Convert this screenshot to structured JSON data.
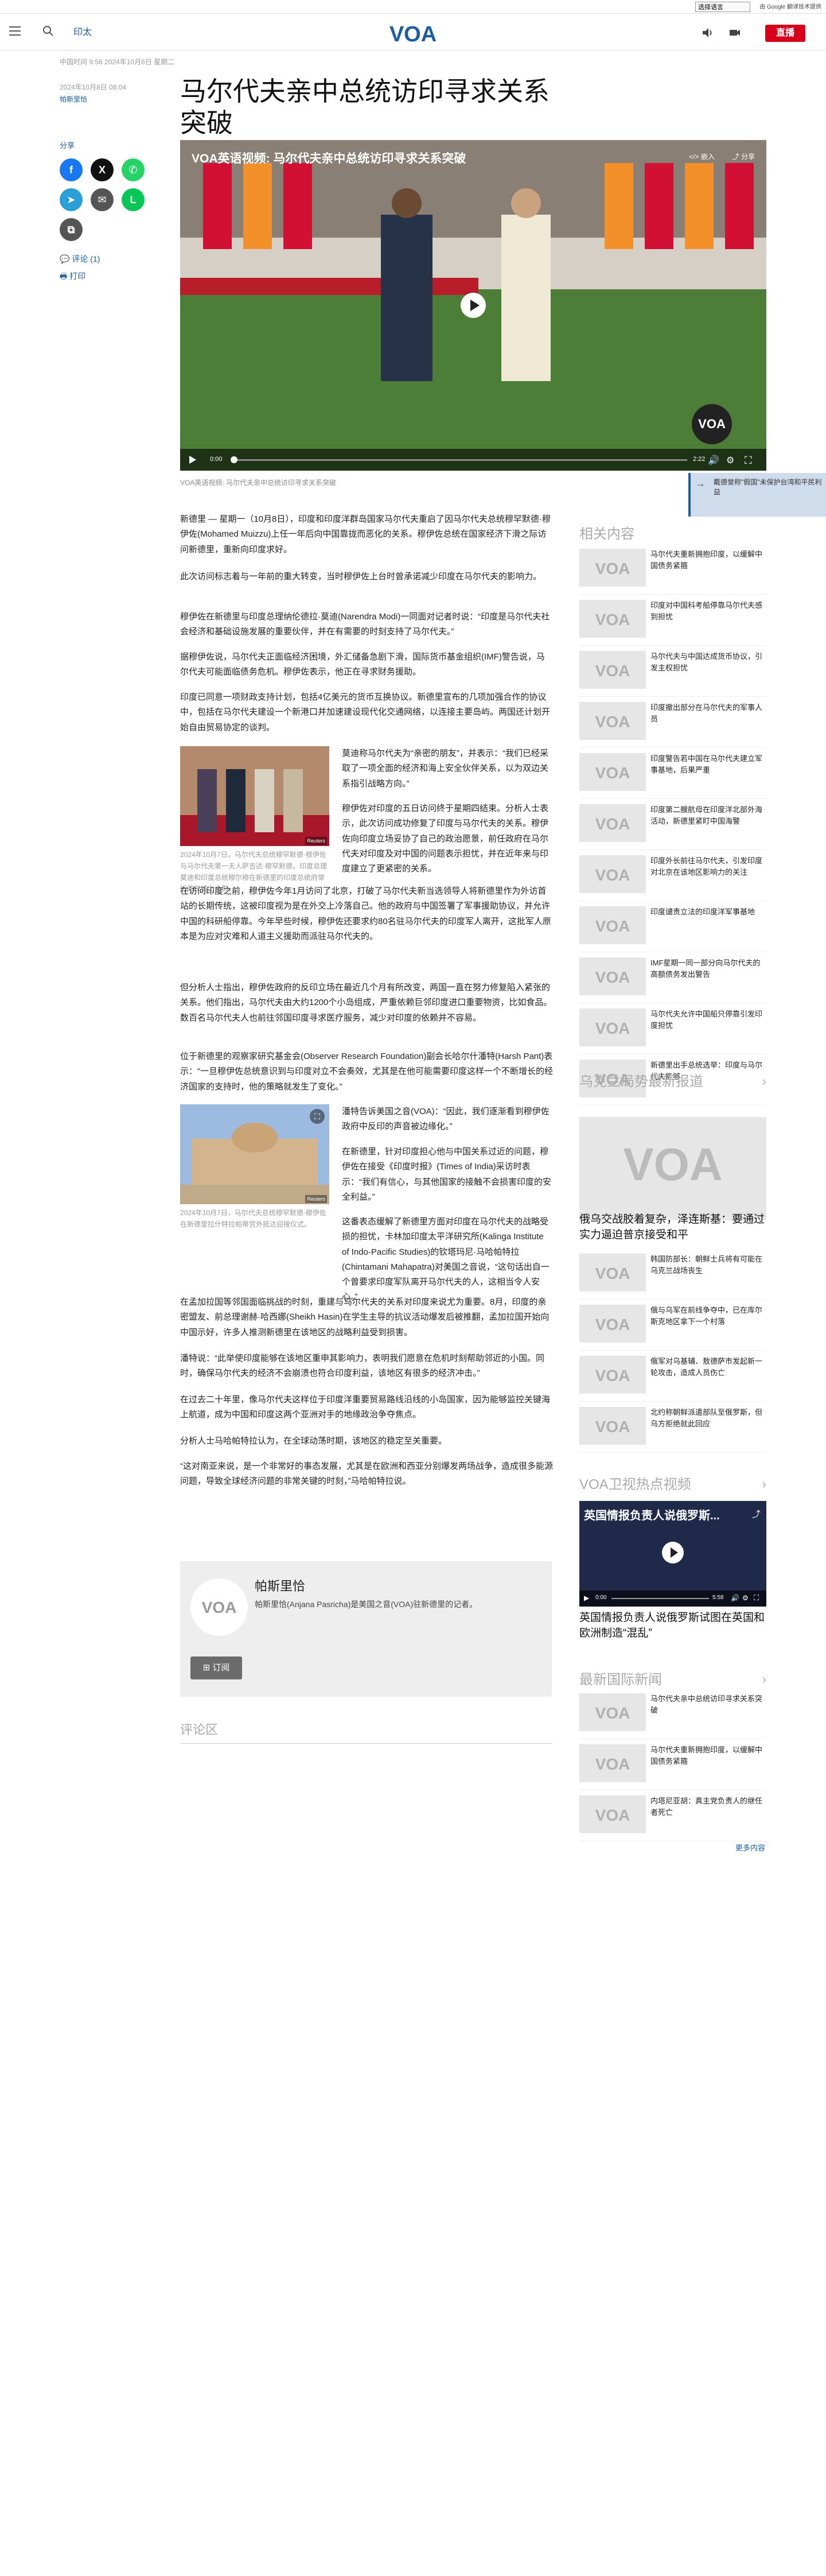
{
  "topbar": {
    "lang_select": "选择语言",
    "translate_label": "由 Google 翻译技术提供"
  },
  "header": {
    "nav_label": "印太",
    "logo_text": "VOA",
    "live_label": "直播"
  },
  "article_meta": {
    "dateline": "中国时间 9:56 2024年10月8日 星期二",
    "updated": "2024年10月8日 08:04",
    "author_link": "帕斯里恰"
  },
  "article": {
    "title": "马尔代夫亲中总统访印寻求关系突破",
    "share_label": "分享",
    "comment_link": "评论 (1)",
    "print_link": "打印",
    "video_title": "VOA英语视频: 马尔代夫亲中总统访印寻求关系突破",
    "video_share": "分享",
    "video_embed": "嵌入",
    "video_time_current": "0:00",
    "video_time_total": "2:22",
    "video_progress": 0.0,
    "video_caption": "VOA英语视频: 马尔代夫亲中总统访印寻求关系突破",
    "paragraphs": [
      "新德里 — 星期一（10月8日），印度和印度洋群岛国家马尔代夫重启了因马尔代夫总统穆罕默德·穆伊佐(Mohamed Muizzu)上任一年后向中国靠拢而恶化的关系。穆伊佐总统在国家经济下滑之际访问新德里，重新向印度求好。",
      "此次访问标志着与一年前的重大转变，当时穆伊佐上台时曾承诺减少印度在马尔代夫的影响力。",
      "穆伊佐在新德里与印度总理纳伦德拉·莫迪(Narendra Modi)一同面对记者时说：“印度是马尔代夫社会经济和基础设施发展的重要伙伴，并在有需要的时刻支持了马尔代夫。”",
      "据穆伊佐说，马尔代夫正面临经济困境，外汇储备急剧下滑，国际货币基金组织(IMF)警告说，马尔代夫可能面临债务危机。穆伊佐表示，他正在寻求财务援助。",
      "印度已同意一项财政支持计划，包括4亿美元的货币互换协议。新德里宣布的几项加强合作的协议中，包括在马尔代夫建设一个新港口并加速建设现代化交通网络，以连接主要岛屿。两国还计划开始自由贸易协定的谈判。",
      "莫迪称马尔代夫为“亲密的朋友”，并表示：“我们已经采取了一项全面的经济和海上安全伙伴关系，以为双边关系指引战略方向。”",
      "穆伊佐对印度的五日访问终于星期四结束。分析人士表示，此次访问成功修复了印度与马尔代夫的关系。穆伊佐向印度立场妥协了自己的政治愿景，前任政府在马尔代夫对印度及对中国的问题表示担忧，并在近年来与印度建立了更紧密的关系。",
      "在访问印度之前，穆伊佐今年1月访问了北京，打破了马尔代夫新当选领导人将新德里作为外访首站的长期传统，这被印度视为是在外交上冷落自己。他的政府与中国签署了军事援助协议，并允许中国的科研船停靠。今年早些时候，穆伊佐还要求约80名驻马尔代夫的印度军人离开，这批军人原本是为应对灾难和人道主义援助而派驻马尔代夫的。",
      "但分析人士指出，穆伊佐政府的反印立场在最近几个月有所改变，两国一直在努力修复陷入紧张的关系。他们指出，马尔代夫由大约1200个小岛组成，严重依赖巨邻印度进口重要物资，比如食品。数百名马尔代夫人也前往邻国印度寻求医疗服务，减少对印度的依赖并不容易。",
      "位于新德里的观察家研究基金会(Observer Research Foundation)副会长哈尔什潘特(Harsh Pant)表示：“一旦穆伊佐总统意识到与印度对立不会奏效，尤其是在他可能需要印度这样一个不断增长的经济国家的支持时，他的策略就发生了变化。”",
      "潘特告诉美国之音(VOA)：“因此，我们逐渐看到穆伊佐政府中反印的声音被边缘化。”",
      "在新德里，针对印度担心他与中国关系过近的问题，穆伊佐在接受《印度时报》(Times of India)采访时表示：“我们有信心，与其他国家的接触不会损害印度的安全利益。”",
      "这番表态缓解了新德里方面对印度在马尔代夫的战略受损的担忧，卡林加印度太平洋研究所(Kalinga Institute of Indo-Pacific Studies)的钦塔玛尼·马哈帕特拉(Chintamani Mahapatra)对美国之音说，“这句话出自一个曾要求印度军队离开马尔代夫的人，这相当令人安心。”",
      "在孟加拉国等邻国面临挑战的时刻，重建与马尔代夫的关系对印度来说尤为重要。8月，印度的亲密盟友、前总理谢赫·哈西娜(Sheikh Hasin)在学生主导的抗议活动爆发后被推翻，孟加拉国开始向中国示好，许多人推测新德里在该地区的战略利益受到损害。",
      "潘特说：“此举使印度能够在该地区重申其影响力，表明我们愿意在危机时刻帮助邻近的小国。同时，确保马尔代夫的经济不会崩溃也符合印度利益，该地区有很多的经济冲击。”",
      "在过去二十年里，像马尔代夫这样位于印度洋重要贸易路线沿线的小岛国家，因为能够监控关键海上航道，成为中国和印度这两个亚洲对手的地缘政治争夺焦点。",
      "分析人士马哈帕特拉认为，在全球动荡时期，该地区的稳定至关重要。",
      "“这对南亚来说，是一个非常好的事态发展，尤其是在欧洲和西亚分别爆发两场战争，造成很多能源问题，导致全球经济问题的非常关键的时刻，”马哈帕特拉说。"
    ],
    "photo1_caption": "2024年10月7日，马尔代夫总统穆罕默德·穆伊佐与马尔代夫第一夫人萨吉达·穆罕默德、印度总理莫迪和印度总统穆尔穆在新德里的印度总统府举行的仪式上合影。",
    "photo1_credit": "Reuters",
    "photo2_caption": "2024年10月7日，马尔代夫总统穆罕默德·穆伊佐在新德里拉什特拉帕蒂宫外抵达迎接仪式。",
    "photo2_credit": "Reuters"
  },
  "author_box": {
    "name": "帕斯里恰",
    "desc": "帕斯里恰(Anjana Pasricha)是美国之音(VOA)驻新德里的记者。",
    "subscribe": "订阅"
  },
  "comments": {
    "heading": "评论区"
  },
  "sidebar": {
    "related_heading": "相关内容",
    "related": [
      "马尔代夫重新拥抱印度，以缓解中国债务紧箍",
      "印度对中国科考船停靠马尔代夫感到担忧",
      "马尔代夫与中国达成货币协议，引发主权担忧",
      "印度撤出部分在马尔代夫的军事人员",
      "印度警告若中国在马尔代夫建立军事基地，后果严重",
      "印度第二艘航母在印度洋北部外海活动，新德里紧盯中国海警",
      "印度外长前往马尔代夫，引发印度对北京在该地区影响力的关注",
      "印度谴责立法的印度洋军事基地",
      "IMF星期一同一部分向马尔代夫的高额债务发出警告",
      "马尔代夫允许中国船只停靠引发印度担忧",
      "新德里出手总统选举：印度与马尔代夫能够"
    ],
    "ukraine_heading": "乌克兰局势最新报道",
    "ukraine_big_title": "俄乌交战胶着复杂，泽连斯基：要通过实力逼迫普京接受和平",
    "ukraine_items": [
      "韩国防部长：朝鲜士兵将有可能在乌克兰战场丧生",
      "俄与乌军在前线争夺中，已在库尔斯克地区拿下一个村落",
      "俄军对乌基辅、敖德萨市发起新一轮攻击，造成人员伤亡",
      "北约称朝鲜派遣部队至俄罗斯，但乌方拒绝就此回应"
    ],
    "tv_heading": "VOA卫视热点视频",
    "tv_video_text": "英国情报负责人说俄罗斯...",
    "tv_time_current": "0:00",
    "tv_time_total": "5:58",
    "tv_title": "英国情报负责人说俄罗斯试图在英国和欧洲制造“混乱”",
    "intl_heading": "最新国际新闻",
    "intl_items": [
      "马尔代夫亲中总统访印寻求关系突破",
      "马尔代夫重新拥抱印度，以缓解中国债务紧箍",
      "内塔尼亚胡：真主党负责人的继任者死亡"
    ],
    "more_label": "更多内容"
  },
  "floating_banner": {
    "text": "戴德誉称\"假国\"未保护台湾和平民利益"
  },
  "colors": {
    "brand_blue": "#1b5ca3",
    "live_red": "#d6001c"
  }
}
